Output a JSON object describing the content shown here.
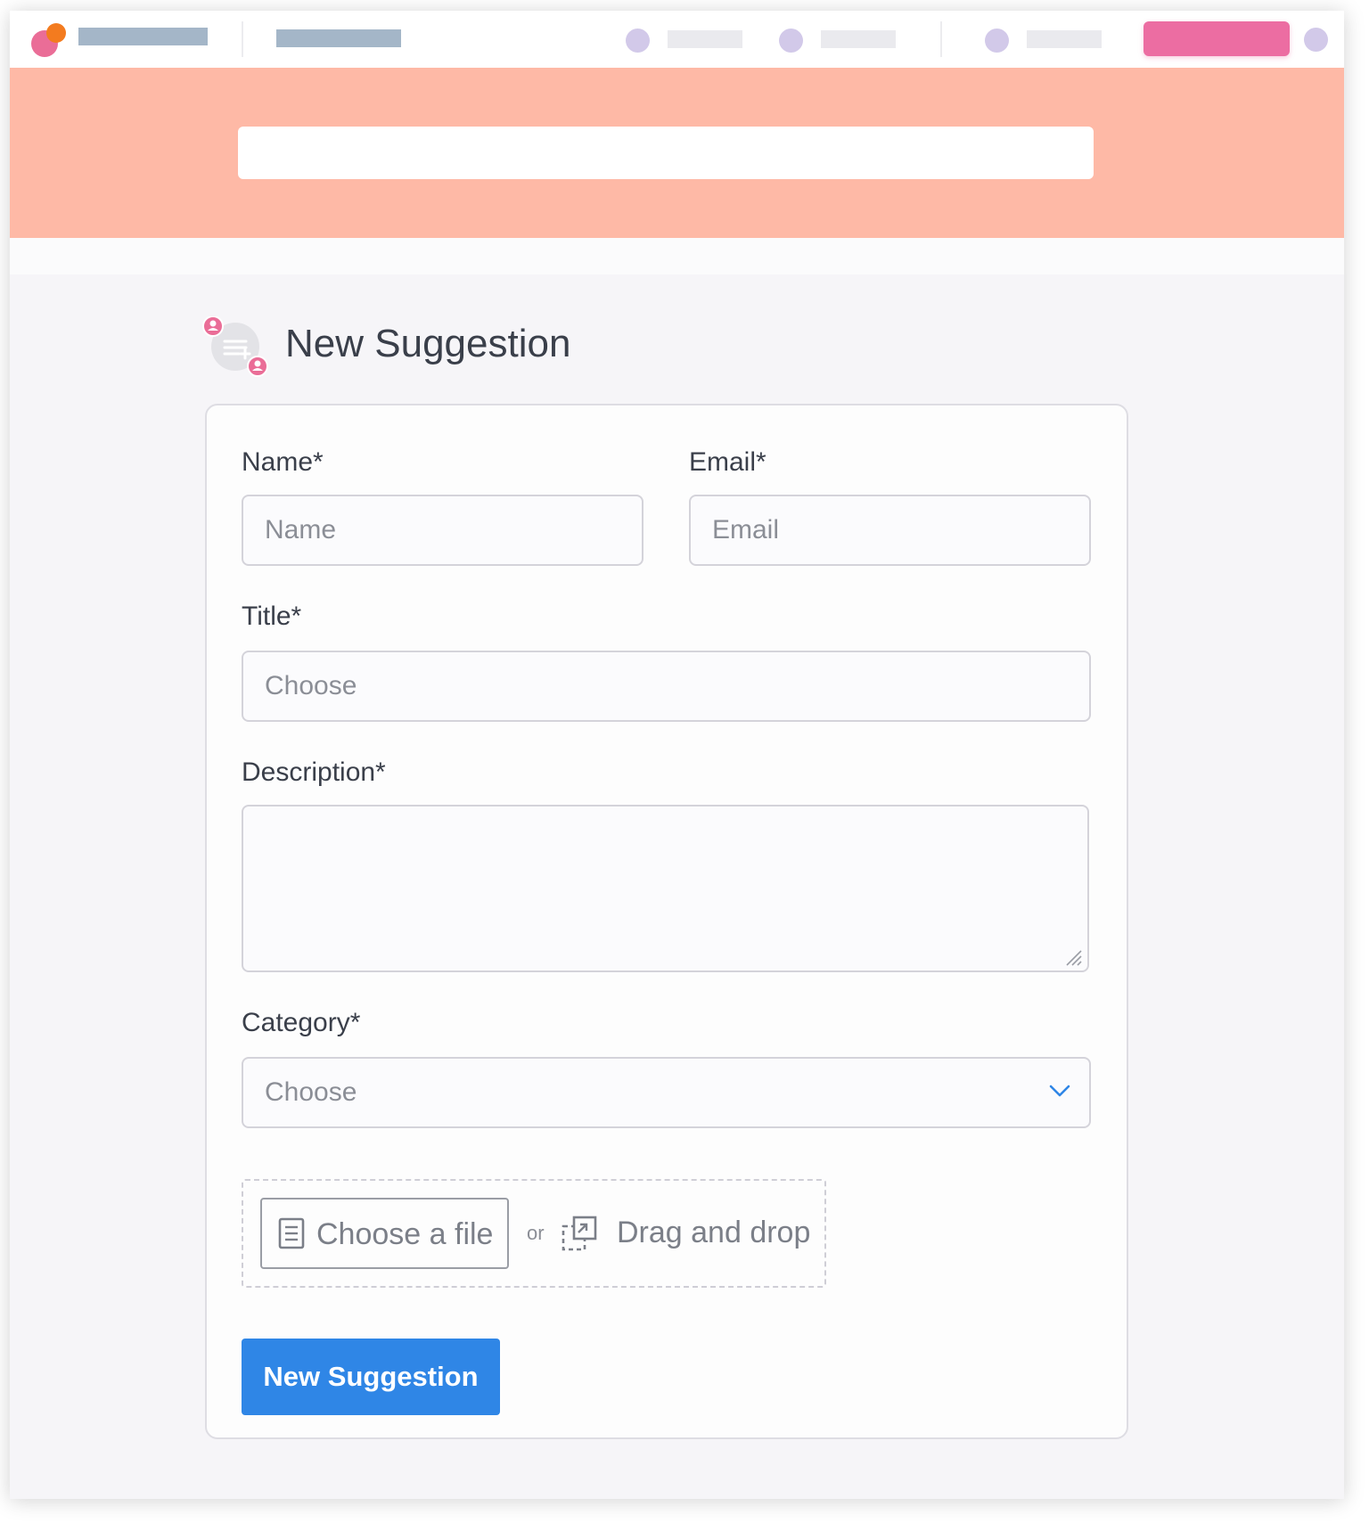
{
  "colors": {
    "logo_pink": "#ea6d97",
    "logo_orange": "#f37b1f",
    "hero_background": "#feb9a6",
    "nav_cta": "#ec6da2",
    "nav_dot": "#d2c9e9",
    "primary_button": "#2f86e6",
    "page_background": "#f6f5f8"
  },
  "heading": {
    "title": "New Suggestion",
    "icon": "suggestion-chat-icon"
  },
  "form": {
    "name": {
      "label": "Name*",
      "placeholder": "Name"
    },
    "email": {
      "label": "Email*",
      "placeholder": "Email"
    },
    "title": {
      "label": "Title*",
      "placeholder": "Choose"
    },
    "description": {
      "label": "Description*",
      "value": ""
    },
    "category": {
      "label": "Category*",
      "selected": "Choose",
      "icon": "chevron-down-icon"
    },
    "upload": {
      "choose_file_label": "Choose a file",
      "choose_file_icon": "document-icon",
      "or_text": "or",
      "drag_drop_label": "Drag and drop",
      "drag_drop_icon": "drag-drop-icon"
    },
    "submit_label": "New Suggestion"
  }
}
